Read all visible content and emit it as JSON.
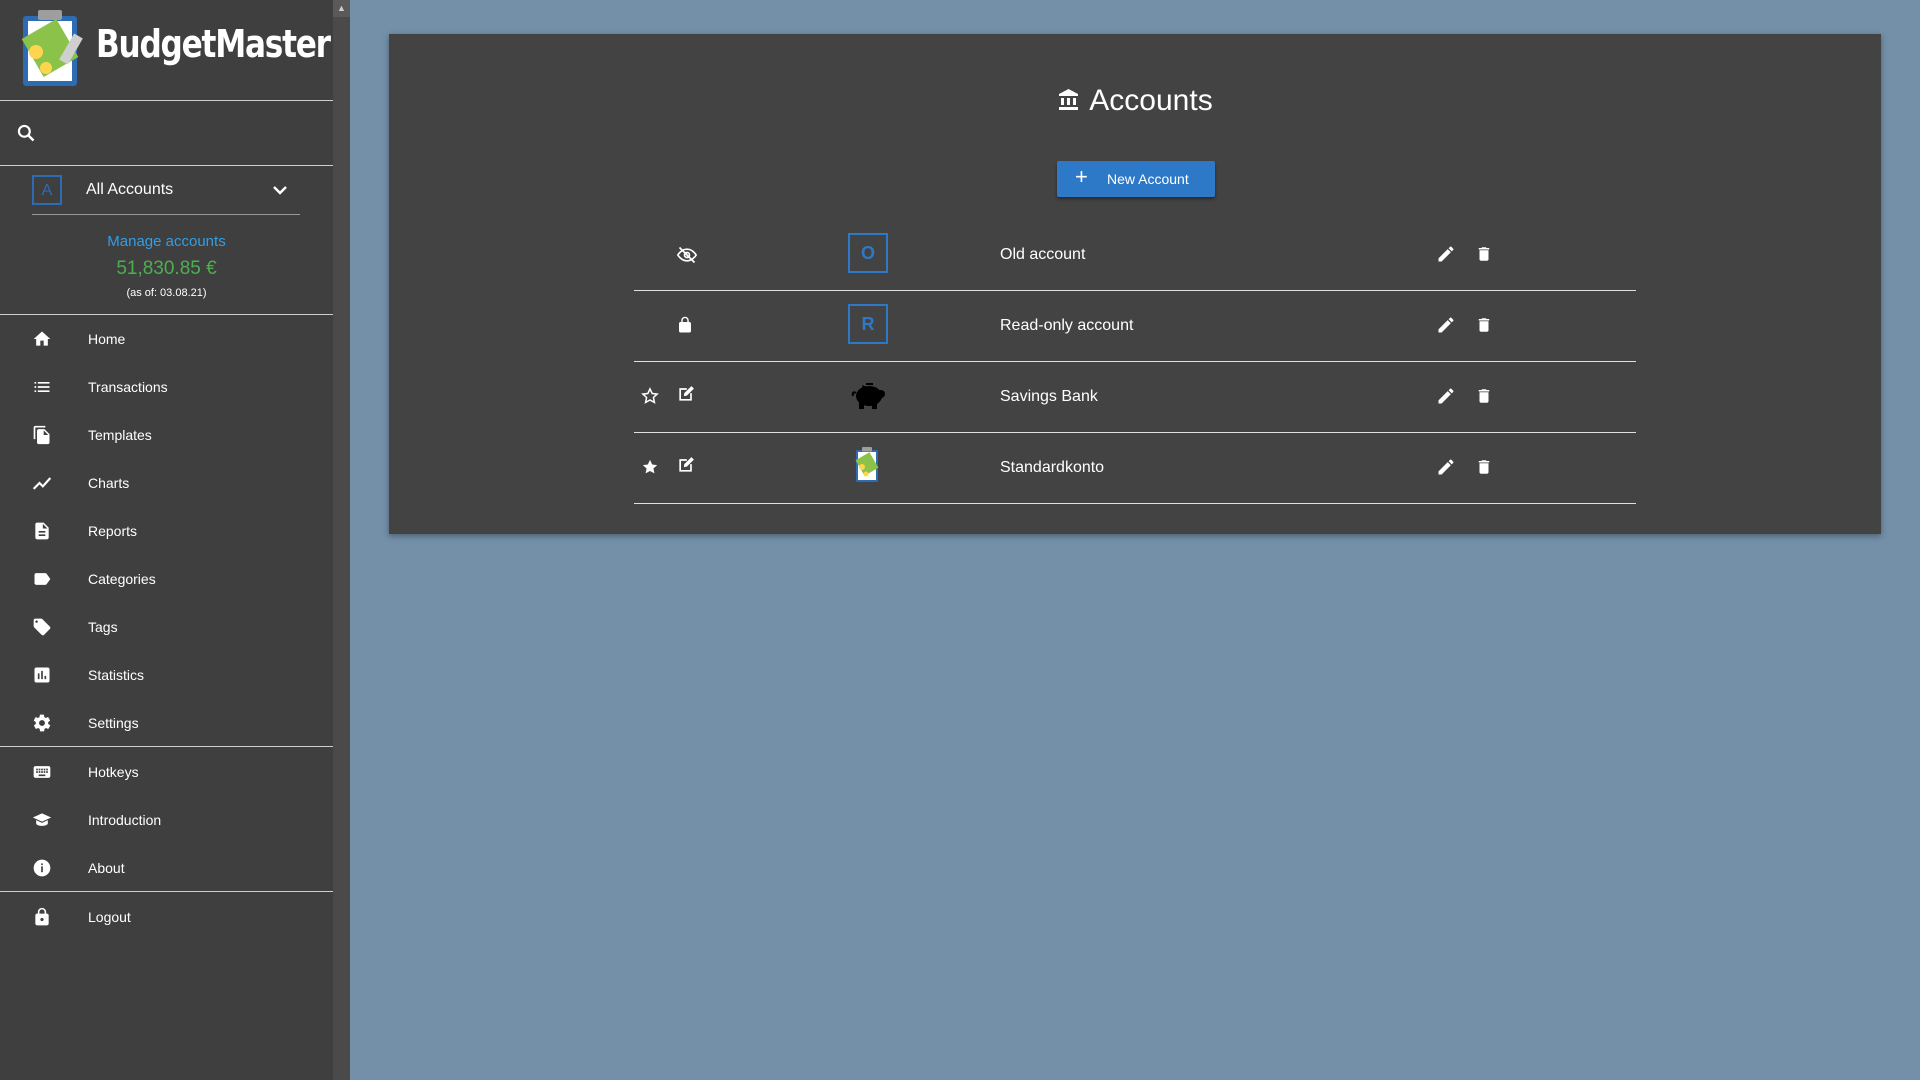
{
  "app": {
    "name": "BudgetMaster"
  },
  "sidebar": {
    "account_select": {
      "badge": "A",
      "label": "All Accounts"
    },
    "manage_link": "Manage accounts",
    "balance": "51,830.85 €",
    "balance_date": "(as of: 03.08.21)",
    "nav": [
      {
        "label": "Home",
        "icon": "home-icon"
      },
      {
        "label": "Transactions",
        "icon": "list-icon"
      },
      {
        "label": "Templates",
        "icon": "copy-icon"
      },
      {
        "label": "Charts",
        "icon": "trending-line-icon"
      },
      {
        "label": "Reports",
        "icon": "document-icon"
      },
      {
        "label": "Categories",
        "icon": "label-icon"
      },
      {
        "label": "Tags",
        "icon": "tag-icon"
      },
      {
        "label": "Statistics",
        "icon": "bar-chart-icon"
      },
      {
        "label": "Settings",
        "icon": "gear-icon"
      },
      {
        "label": "Hotkeys",
        "icon": "keyboard-icon"
      },
      {
        "label": "Introduction",
        "icon": "graduation-cap-icon"
      },
      {
        "label": "About",
        "icon": "info-icon"
      },
      {
        "label": "Logout",
        "icon": "lock-icon"
      }
    ]
  },
  "main": {
    "title": "Accounts",
    "new_button": "New Account",
    "accounts": [
      {
        "name": "Old account",
        "icon_letter": "O",
        "status": "hidden"
      },
      {
        "name": "Read-only account",
        "icon_letter": "R",
        "status": "read-only"
      },
      {
        "name": "Savings Bank",
        "icon": "piggy-bank-icon",
        "status": "editable",
        "default": false
      },
      {
        "name": "Standardkonto",
        "icon": "budgetmaster-logo-icon",
        "status": "editable",
        "default": true
      }
    ]
  },
  "colors": {
    "accent": "#2d79c7",
    "balance": "#4caf50",
    "link": "#2f9fe8",
    "sidebar_bg": "#3f3f3f",
    "page_bg": "#7390a8"
  }
}
